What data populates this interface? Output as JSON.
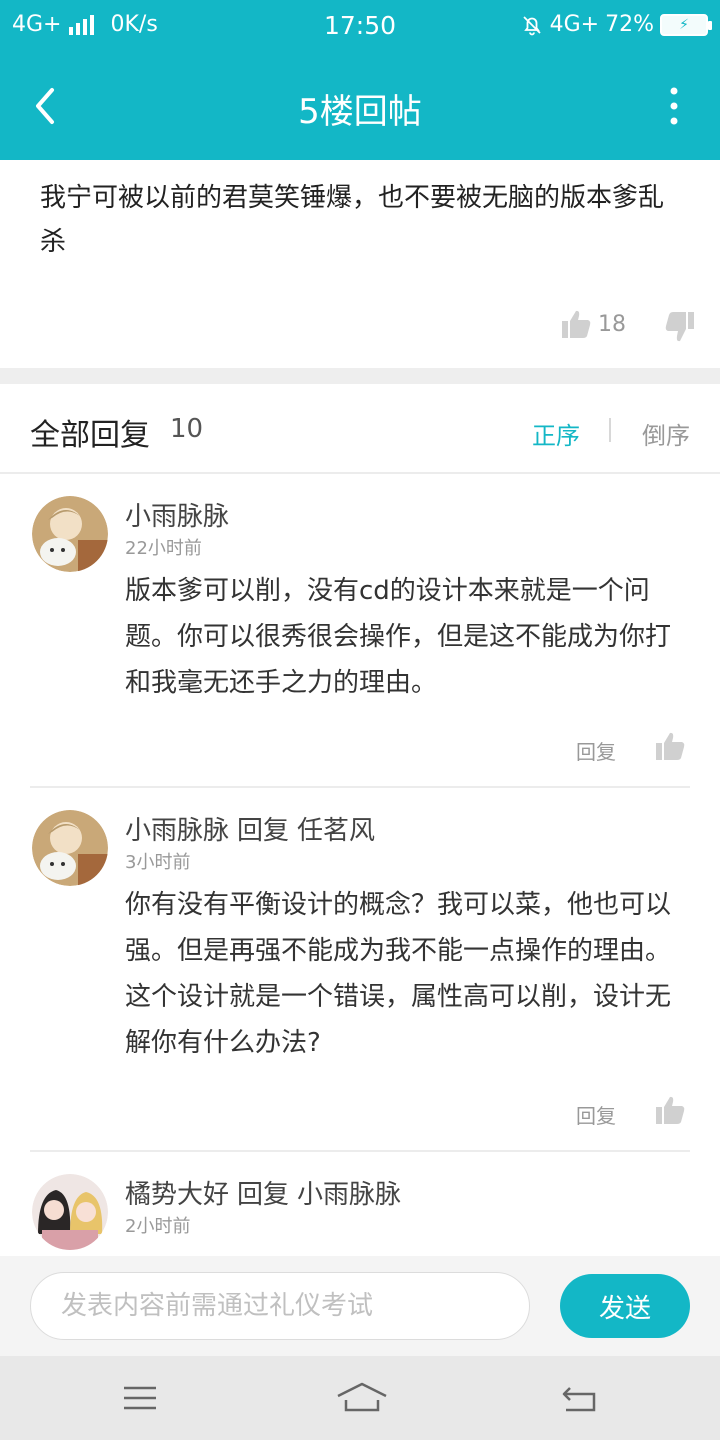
{
  "status_bar": {
    "network": "4G+",
    "speed": "0K/s",
    "time": "17:50",
    "network_right": "4G+",
    "battery_percent": "72%",
    "signal_level": 4
  },
  "nav": {
    "title": "5楼回帖"
  },
  "op": {
    "text": "我宁可被以前的君莫笑锤爆，也不要被无脑的版本爹乱杀",
    "likes": "18"
  },
  "replies_header": {
    "label": "全部回复",
    "count": "10",
    "sort_asc": "正序",
    "sort_desc": "倒序"
  },
  "replies": [
    {
      "author": "小雨脉脉",
      "reply_to_verb": "",
      "reply_to": "",
      "time": "22小时前",
      "body": "版本爹可以削，没有cd的设计本来就是一个问题。你可以很秀很会操作，但是这不能成为你打和我毫无还手之力的理由。",
      "reply_label": "回复"
    },
    {
      "author": "小雨脉脉",
      "reply_to_verb": "回复",
      "reply_to": "任茗风",
      "time": "3小时前",
      "body": "你有没有平衡设计的概念？我可以菜，他也可以强。但是再强不能成为我不能一点操作的理由。这个设计就是一个错误，属性高可以削，设计无解你有什么办法?",
      "reply_label": "回复"
    },
    {
      "author": "橘势大好",
      "reply_to_verb": "回复",
      "reply_to": "小雨脉脉",
      "time": "2小时前"
    }
  ],
  "input": {
    "placeholder": "发表内容前需通过礼仪考试",
    "send_label": "发送"
  },
  "colors": {
    "accent": "#13b7c6",
    "divider": "#eeeeee"
  },
  "icons": {
    "back": "chevron-left-icon",
    "more": "more-vertical-icon",
    "like": "thumbs-up-icon",
    "dislike": "thumbs-down-icon",
    "mute": "bell-off-icon",
    "menu": "menu-icon",
    "home": "home-icon",
    "return": "back-icon"
  }
}
